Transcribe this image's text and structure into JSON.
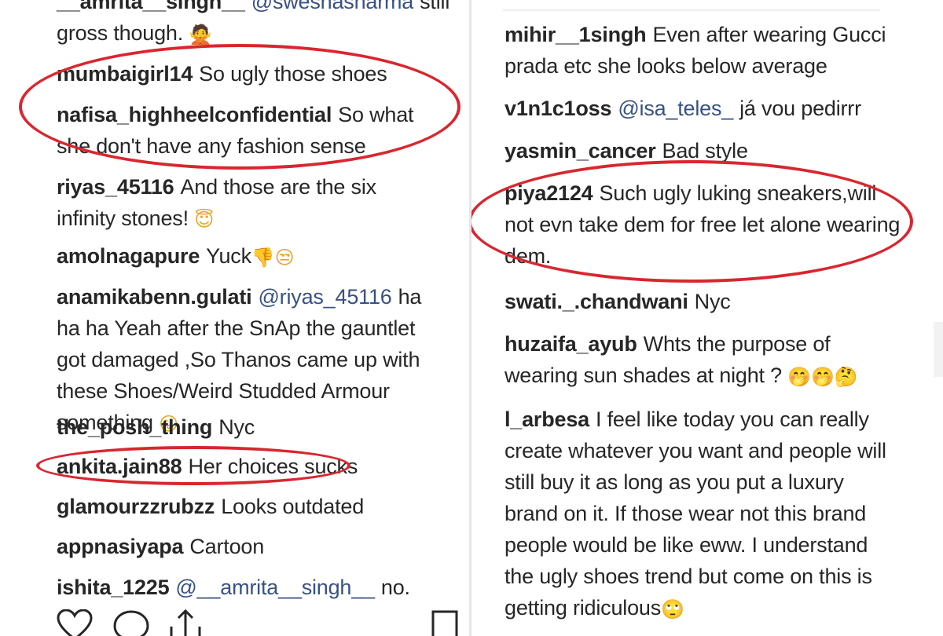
{
  "left": {
    "comments": [
      {
        "user": "__amrita__singh__",
        "mention": "@swesnasharma",
        "text": "still gross though.",
        "emoji": "🙅"
      },
      {
        "user": "mumbaigirl14",
        "mention": "",
        "text": "So ugly those shoes",
        "emoji": ""
      },
      {
        "user": "nafisa_highheelconfidential",
        "mention": "",
        "text": "So what she don't have any fashion sense",
        "emoji": ""
      },
      {
        "user": "riyas_45116",
        "mention": "",
        "text": "And those are the six infinity stones!",
        "emoji": "😇"
      },
      {
        "user": "amolnagapure",
        "mention": "",
        "text": "Yuck",
        "emoji": "👎😒"
      },
      {
        "user": "anamikabenn.gulati",
        "mention": "@riyas_45116",
        "text": "ha ha ha Yeah after the SnAp the gauntlet got damaged ,So Thanos came up with these Shoes/Weird Studded Armour something",
        "emoji": "😛"
      },
      {
        "user": "the_posh_thing",
        "mention": "",
        "text": "Nyc",
        "emoji": ""
      },
      {
        "user": "ankita.jain88",
        "mention": "",
        "text": "Her choices sucks",
        "emoji": ""
      },
      {
        "user": "glamourzzrubzz",
        "mention": "",
        "text": "Looks outdated",
        "emoji": ""
      },
      {
        "user": "appnasiyapa",
        "mention": "",
        "text": "Cartoon",
        "emoji": ""
      },
      {
        "user": "ishita_1225",
        "mention": "@__amrita__singh__",
        "text": "no.",
        "emoji": ""
      }
    ],
    "actions": {
      "like_icon": "heart-icon",
      "comment_icon": "comment-icon",
      "share_icon": "share-icon",
      "save_icon": "bookmark-icon"
    }
  },
  "right": {
    "comments": [
      {
        "user": "mihir__1singh",
        "mention": "",
        "text": "Even after wearing Gucci prada etc she looks below average",
        "emoji": ""
      },
      {
        "user": "v1n1c1oss",
        "mention": "@isa_teles_",
        "text": "já vou pedirrr",
        "emoji": ""
      },
      {
        "user": "yasmin_cancer",
        "mention": "",
        "text": "Bad style",
        "emoji": ""
      },
      {
        "user": "piya2124",
        "mention": "",
        "text": "Such ugly luking sneakers,will not evn take dem for free let alone wearing dem.",
        "emoji": ""
      },
      {
        "user": "swati._.chandwani",
        "mention": "",
        "text": "Nyc",
        "emoji": ""
      },
      {
        "user": "huzaifa_ayub",
        "mention": "",
        "text": "Whts the purpose of wearing sun shades at night ?",
        "emoji": "🤭🤭🤔"
      },
      {
        "user": "l_arbesa",
        "mention": "",
        "text": "I feel like today you can really create whatever you want and people will still buy it as long as you put a luxury brand on it. If those wear not this brand people would be like eww. I understand the ugly shoes trend but come on this is getting ridiculous",
        "emoji": "🙄"
      }
    ]
  },
  "colors": {
    "highlight": "#d9262f",
    "mention": "#385185",
    "text": "#262626"
  }
}
